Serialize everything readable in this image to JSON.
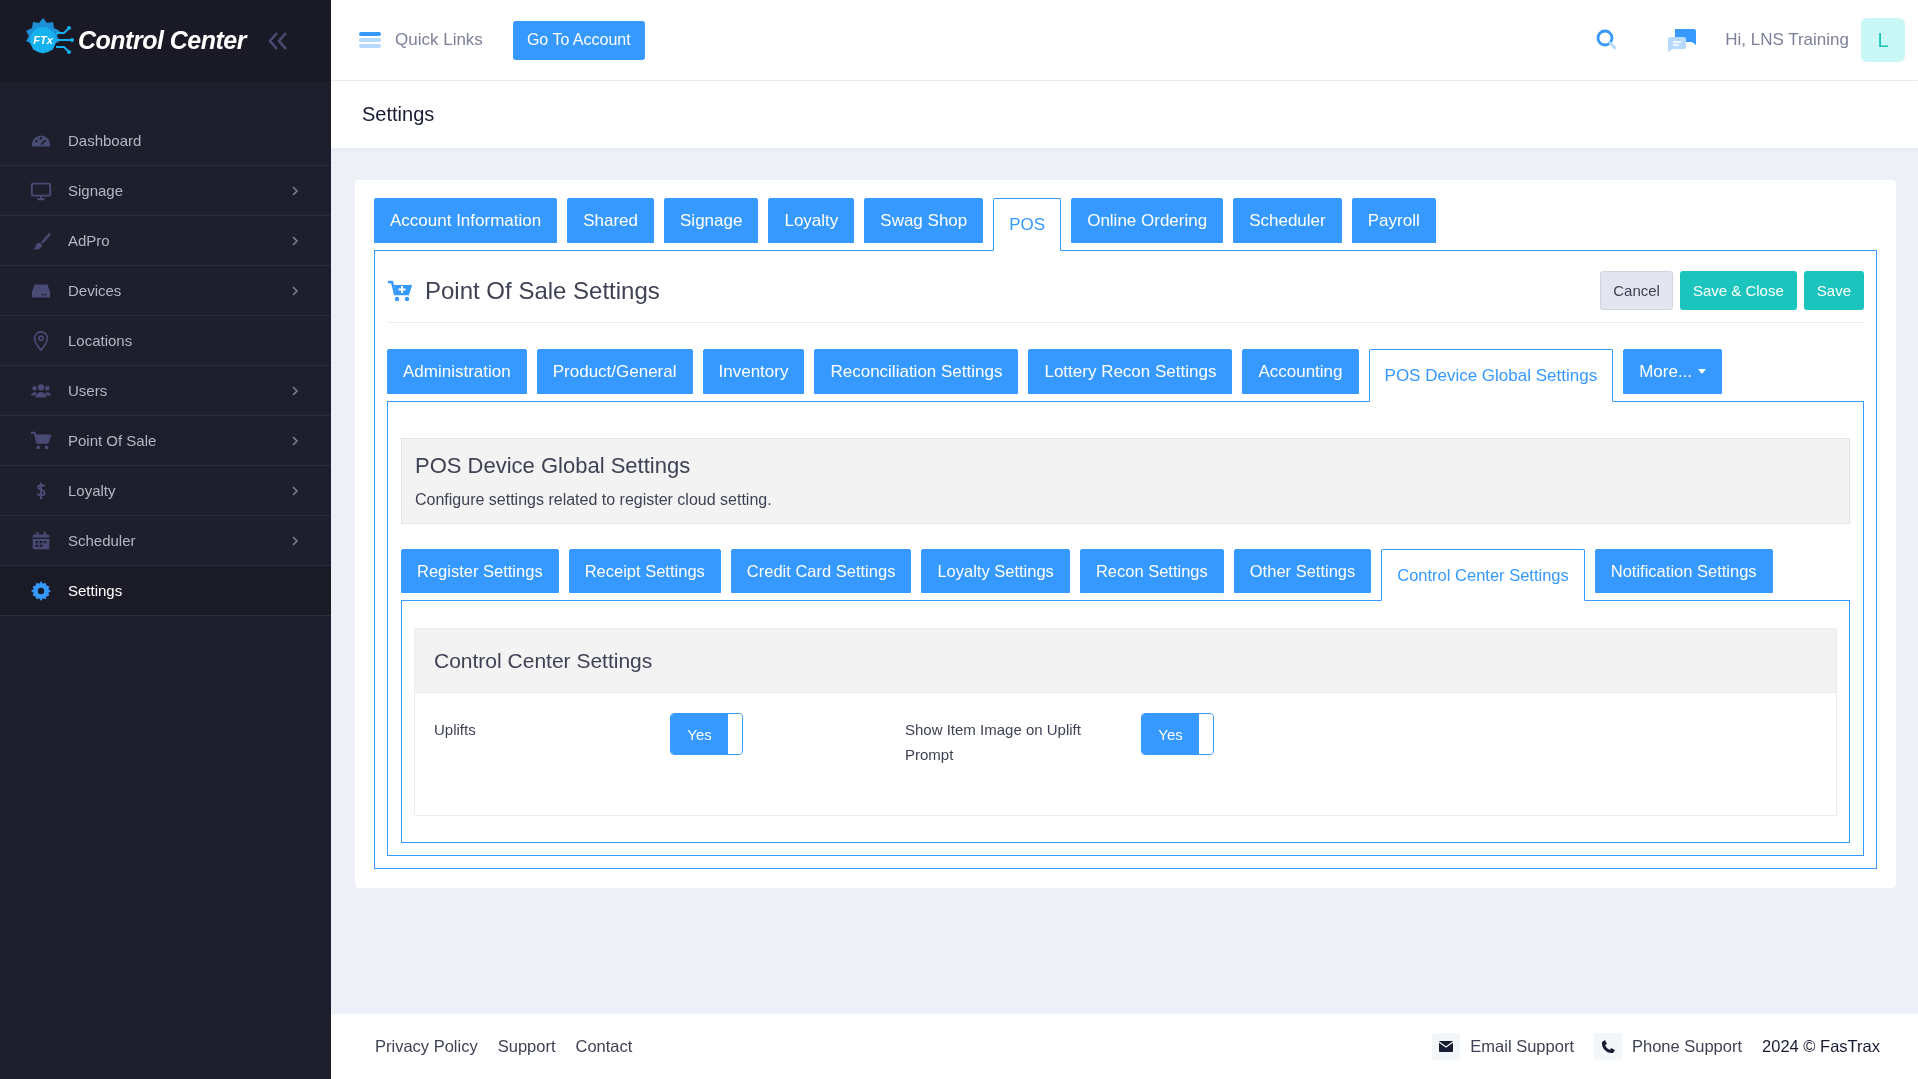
{
  "sidebar": {
    "logo_badge": "FTx",
    "logo_text": "Control Center",
    "items": [
      {
        "label": "Dashboard",
        "has_submenu": false,
        "selected": false
      },
      {
        "label": "Signage",
        "has_submenu": true,
        "selected": false
      },
      {
        "label": "AdPro",
        "has_submenu": true,
        "selected": false
      },
      {
        "label": "Devices",
        "has_submenu": true,
        "selected": false
      },
      {
        "label": "Locations",
        "has_submenu": false,
        "selected": false
      },
      {
        "label": "Users",
        "has_submenu": true,
        "selected": false
      },
      {
        "label": "Point Of Sale",
        "has_submenu": true,
        "selected": false
      },
      {
        "label": "Loyalty",
        "has_submenu": true,
        "selected": false
      },
      {
        "label": "Scheduler",
        "has_submenu": true,
        "selected": false
      },
      {
        "label": "Settings",
        "has_submenu": false,
        "selected": true
      }
    ]
  },
  "topbar": {
    "quick_links": "Quick Links",
    "account_button": "Go To Account",
    "greeting": "Hi, LNS Training",
    "avatar": "L"
  },
  "page_title": "Settings",
  "main_tabs": [
    {
      "label": "Account Information",
      "selected": false
    },
    {
      "label": "Shared",
      "selected": false
    },
    {
      "label": "Signage",
      "selected": false
    },
    {
      "label": "Loyalty",
      "selected": false
    },
    {
      "label": "Swag Shop",
      "selected": false
    },
    {
      "label": "POS",
      "selected": true
    },
    {
      "label": "Online Ordering",
      "selected": false
    },
    {
      "label": "Scheduler",
      "selected": false
    },
    {
      "label": "Payroll",
      "selected": false
    }
  ],
  "pos_settings": {
    "title": "Point Of Sale Settings",
    "buttons": [
      {
        "label": "Cancel",
        "kind": "cancel"
      },
      {
        "label": "Save & Close",
        "kind": "save"
      },
      {
        "label": "Save",
        "kind": "save"
      }
    ],
    "tabs": [
      {
        "label": "Administration",
        "selected": false,
        "kind": "tab"
      },
      {
        "label": "Product/General",
        "selected": false,
        "kind": "tab"
      },
      {
        "label": "Inventory",
        "selected": false,
        "kind": "tab"
      },
      {
        "label": "Reconciliation Settings",
        "selected": false,
        "kind": "tab"
      },
      {
        "label": "Lottery Recon Settings",
        "selected": false,
        "kind": "tab"
      },
      {
        "label": "Accounting",
        "selected": false,
        "kind": "tab"
      },
      {
        "label": "POS Device Global Settings",
        "selected": true,
        "kind": "tab"
      },
      {
        "label": "More...",
        "selected": false,
        "kind": "dropdown"
      }
    ]
  },
  "section": {
    "title": "POS Device Global Settings",
    "description": "Configure settings related to register cloud setting.",
    "tabs": [
      {
        "label": "Register Settings",
        "selected": false
      },
      {
        "label": "Receipt Settings",
        "selected": false
      },
      {
        "label": "Credit Card Settings",
        "selected": false
      },
      {
        "label": "Loyalty Settings",
        "selected": false
      },
      {
        "label": "Recon Settings",
        "selected": false
      },
      {
        "label": "Other Settings",
        "selected": false
      },
      {
        "label": "Control Center Settings",
        "selected": true
      },
      {
        "label": "Notification Settings",
        "selected": false
      }
    ],
    "panel": {
      "title": "Control Center Settings",
      "settings": [
        {
          "label": "Uplifts",
          "value": "Yes",
          "on": true
        },
        {
          "label": "Show Item Image on Uplift Prompt",
          "value": "Yes",
          "on": true
        }
      ]
    }
  },
  "footer": {
    "links": [
      "Privacy Policy",
      "Support",
      "Contact"
    ],
    "email": "Email Support",
    "phone": "Phone Support",
    "copyright": "2024 © FasTrax"
  }
}
